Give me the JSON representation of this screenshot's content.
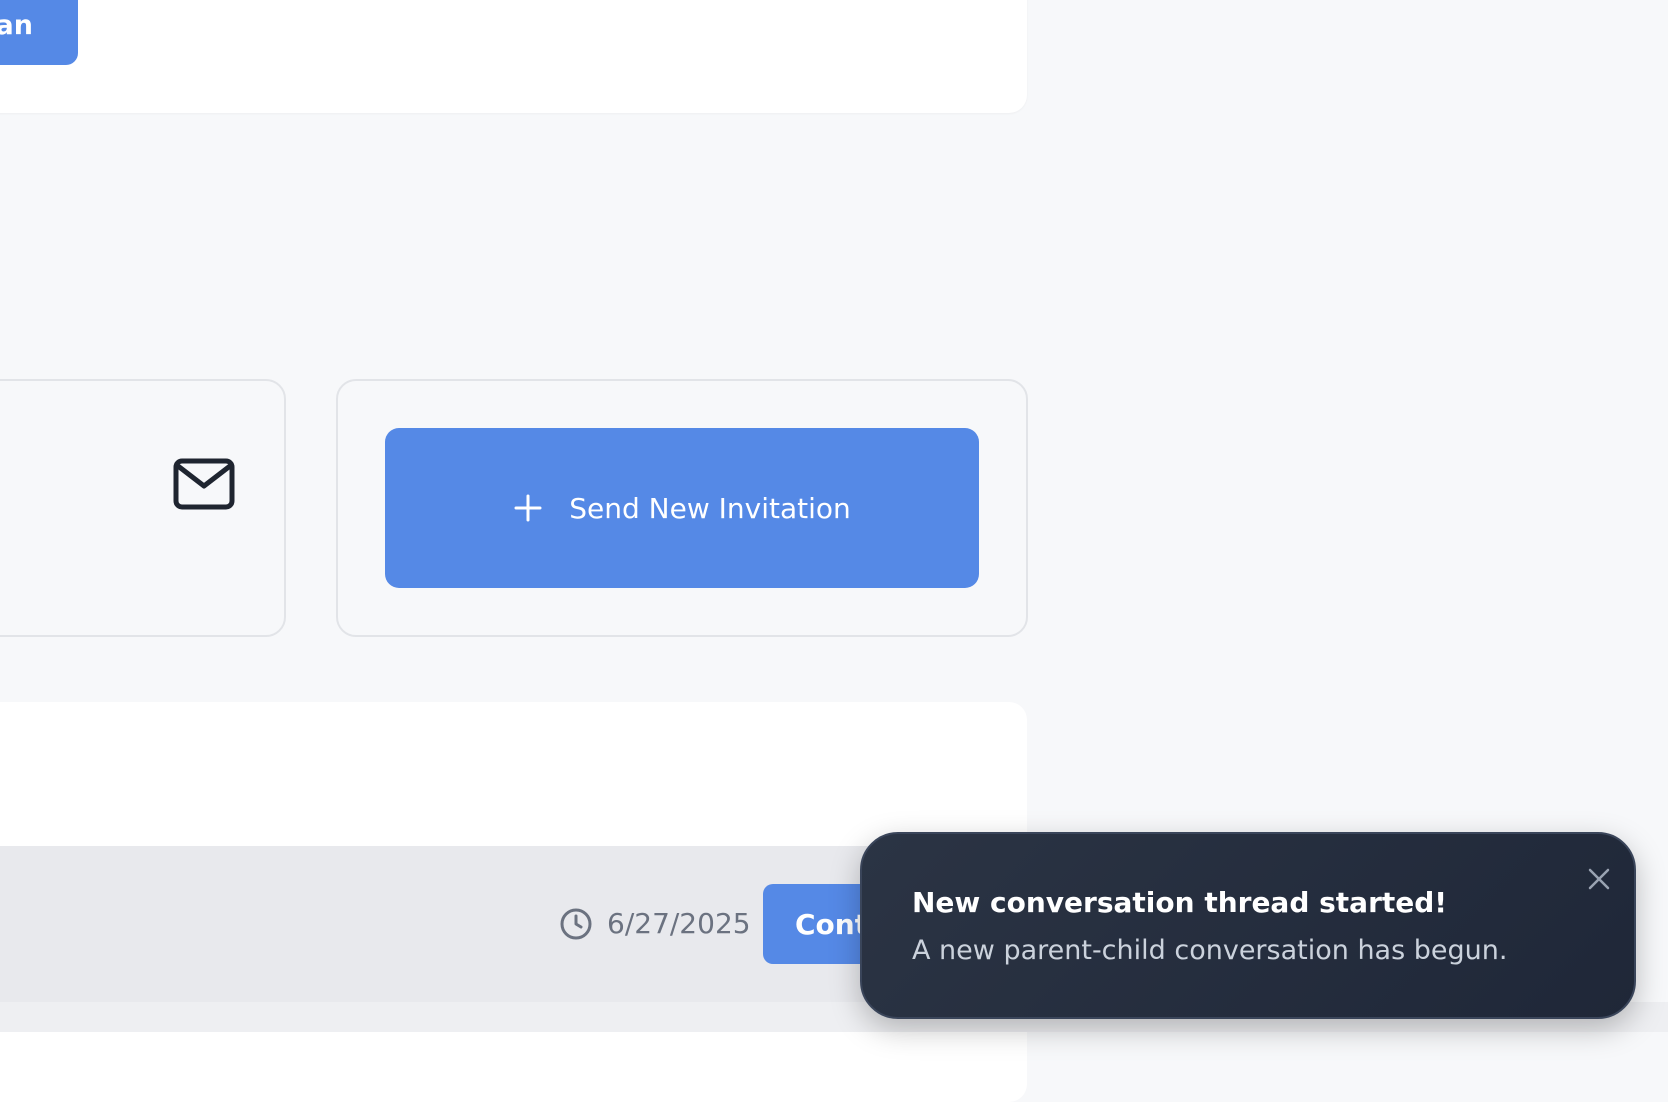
{
  "top_card": {
    "button_label": "an"
  },
  "invite_card": {
    "button_label": "Send New Invitation",
    "icon": "plus-icon"
  },
  "mail_card": {
    "icon": "mail-icon"
  },
  "footer": {
    "date": "6/27/2025",
    "continue_label": "Cont",
    "icon": "clock-icon"
  },
  "toast": {
    "title": "New conversation thread started!",
    "message": "A new parent-child conversation has begun.",
    "close_icon": "close-icon"
  },
  "colors": {
    "accent": "#5589e6",
    "toast_bg": "#1f2738",
    "page_bg": "#f7f8fa"
  }
}
